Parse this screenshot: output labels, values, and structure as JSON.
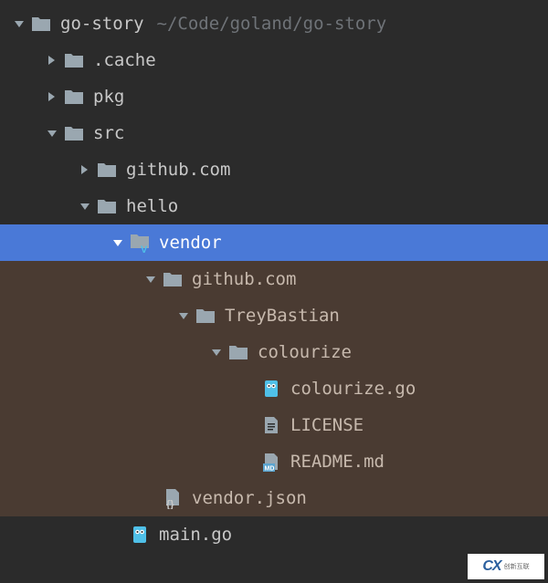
{
  "root": {
    "name": "go-story",
    "path_hint": "~/Code/goland/go-story"
  },
  "nodes": {
    "cache": ".cache",
    "pkg": "pkg",
    "src": "src",
    "github_outer": "github.com",
    "hello": "hello",
    "vendor": "vendor",
    "github_inner": "github.com",
    "treybastian": "TreyBastian",
    "colourize": "colourize",
    "colourize_go": "colourize.go",
    "license": "LICENSE",
    "readme": "README.md",
    "vendor_json": "vendor.json",
    "main_go": "main.go"
  },
  "watermark": {
    "logo": "CX",
    "text": "创新互联"
  },
  "colors": {
    "selection": "#4a79d7",
    "vendor_bg": "#4a3b32",
    "folder": "#9aa7b0",
    "go_icon": "#4fc0e8",
    "md_badge": "#5ba4cf"
  }
}
